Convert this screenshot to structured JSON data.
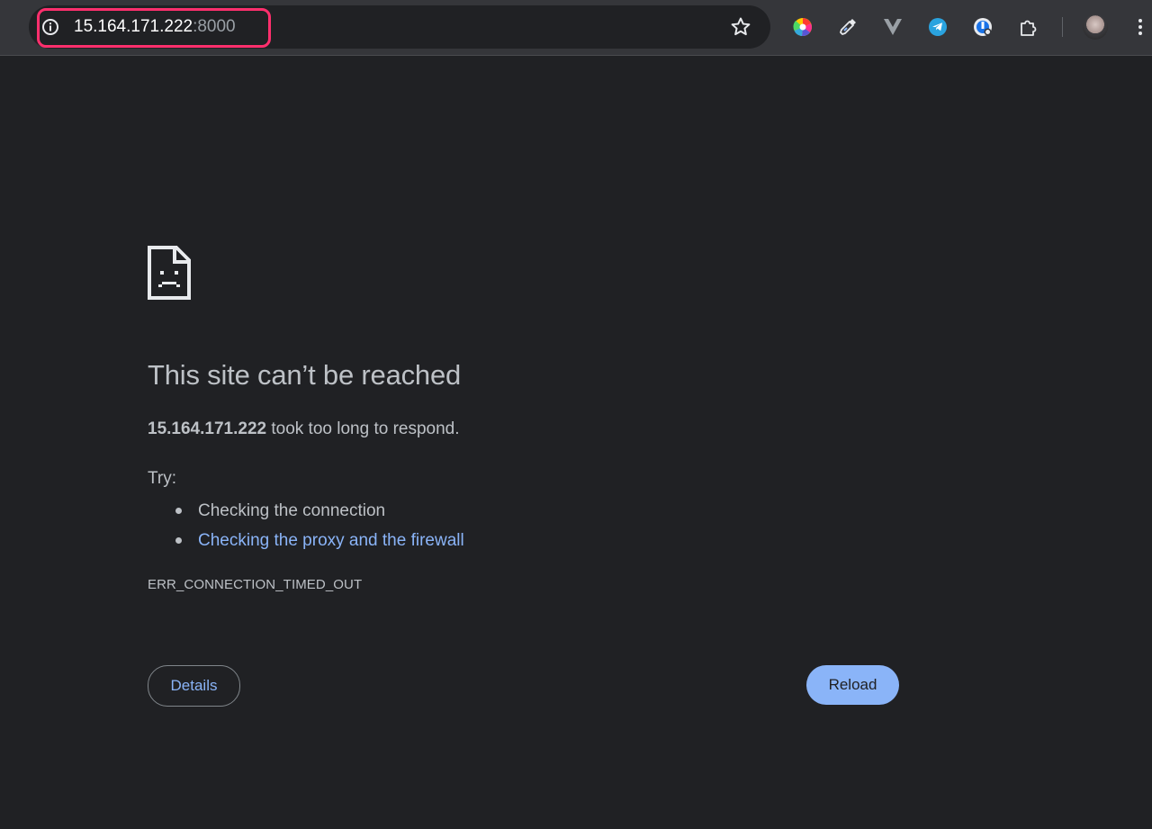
{
  "browser": {
    "url_host": "15.164.171.222",
    "url_port": ":8000",
    "highlight_color": "#ff2f6d",
    "extensions": [
      "color-picker-icon",
      "eyedropper-icon",
      "vuetify-icon",
      "telegram-icon",
      "password-manager-icon",
      "puzzle-icon"
    ]
  },
  "error_page": {
    "title": "This site can’t be reached",
    "host": "15.164.171.222",
    "message_suffix": " took too long to respond.",
    "try_label": "Try:",
    "suggestions": {
      "check_connection": "Checking the connection",
      "check_proxy_firewall": "Checking the proxy and the firewall"
    },
    "error_code": "ERR_CONNECTION_TIMED_OUT",
    "details_button": "Details",
    "reload_button": "Reload",
    "link_color": "#8ab4f8",
    "primary_button_color": "#8ab4f8"
  }
}
